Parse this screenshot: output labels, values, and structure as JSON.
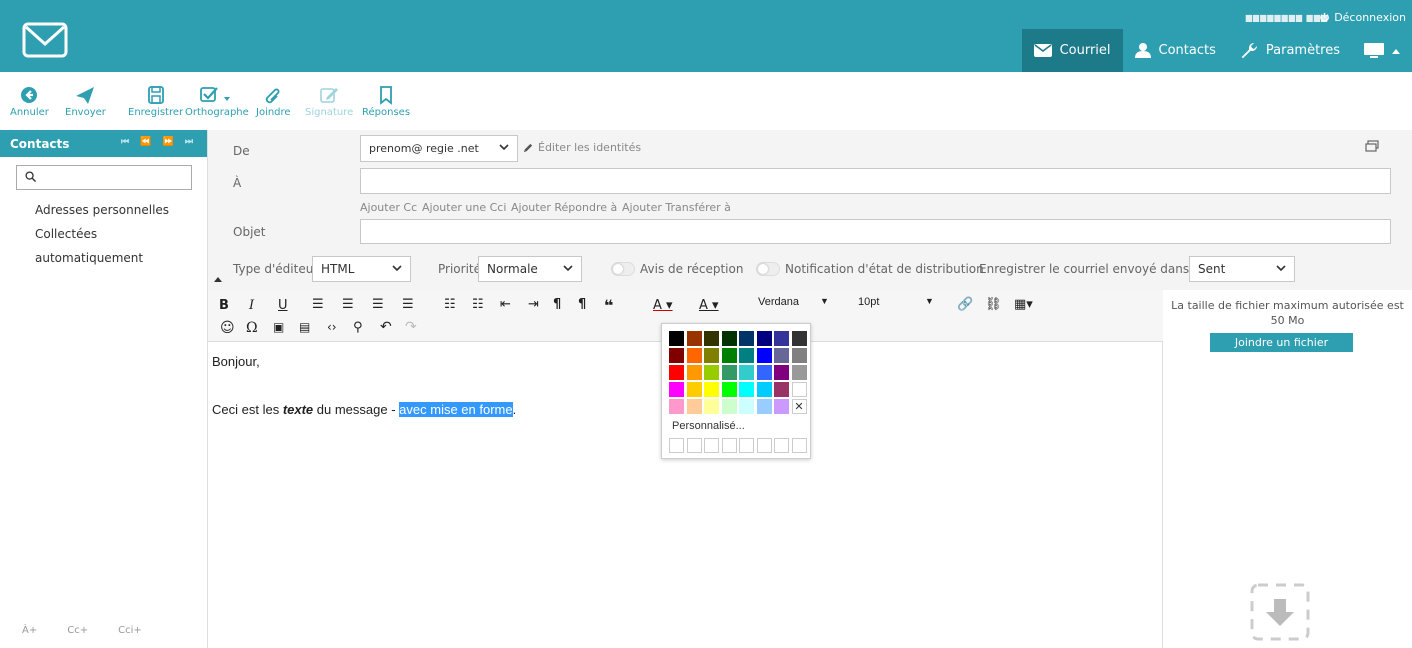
{
  "header": {
    "user": "▆▆▆▆▆▆▆▆  ▆▆▆",
    "logout": "Déconnexion",
    "nav": {
      "mail": "Courriel",
      "contacts": "Contacts",
      "settings": "Paramètres"
    }
  },
  "toolbar": {
    "cancel": "Annuler",
    "send": "Envoyer",
    "save": "Enregistrer",
    "spell": "Orthographe",
    "attach": "Joindre",
    "signature": "Signature",
    "responses": "Réponses"
  },
  "sidebar": {
    "title": "Contacts",
    "pager": "⏮ ⏪ ⏩ ⏭",
    "search_placeholder": "",
    "items": [
      "Adresses personnelles",
      "Collectées automatiquement"
    ],
    "footer": [
      "À+",
      "Cc+",
      "Cci+"
    ]
  },
  "compose": {
    "from_label": "De",
    "from_value": "prenom@ regie .net",
    "edit_identities": "Éditer les identités",
    "to_label": "À",
    "to_value": "",
    "add_cc": "Ajouter Cc",
    "add_bcc": "Ajouter une Cci",
    "add_reply": "Ajouter Répondre à",
    "add_forward": "Ajouter Transférer à",
    "subject_label": "Objet",
    "subject_value": "",
    "editor_type_label": "Type d'éditeur",
    "editor_type_value": "HTML",
    "priority_label": "Priorité",
    "priority_value": "Normale",
    "receipt_label": "Avis de réception",
    "dsn_label": "Notification d'état de distribution",
    "save_in_label": "Enregistrer le courriel envoyé dans",
    "save_in_value": "Sent"
  },
  "editor": {
    "font_family": "Verdana",
    "font_size": "10pt",
    "greeting": "Bonjour,",
    "line_prefix": "Ceci est les ",
    "line_bold": "texte",
    "line_mid": " du message - ",
    "line_selected": "avec mise en forme",
    "line_suffix": "."
  },
  "picker": {
    "custom_label": "Personnalisé...",
    "colors": [
      [
        "#000000",
        "#993300",
        "#333300",
        "#003300",
        "#003366",
        "#000080",
        "#333399",
        "#333333"
      ],
      [
        "#800000",
        "#ff6600",
        "#808000",
        "#008000",
        "#008080",
        "#0000ff",
        "#666699",
        "#808080"
      ],
      [
        "#ff0000",
        "#ff9900",
        "#99cc00",
        "#339966",
        "#33cccc",
        "#3366ff",
        "#800080",
        "#999999"
      ],
      [
        "#ff00ff",
        "#ffcc00",
        "#ffff00",
        "#00ff00",
        "#00ffff",
        "#00ccff",
        "#993366",
        "#ffffff"
      ],
      [
        "#ff99cc",
        "#ffcc99",
        "#ffff99",
        "#ccffcc",
        "#ccffff",
        "#99ccff",
        "#cc99ff",
        "remove"
      ]
    ]
  },
  "attach": {
    "max_size_info": "La taille de fichier maximum autorisée est 50 Mo",
    "button": "Joindre un fichier"
  },
  "colors": {
    "brand": "#2d9fb1",
    "brand_dark": "#1c7a89",
    "selection": "#3399ff"
  }
}
